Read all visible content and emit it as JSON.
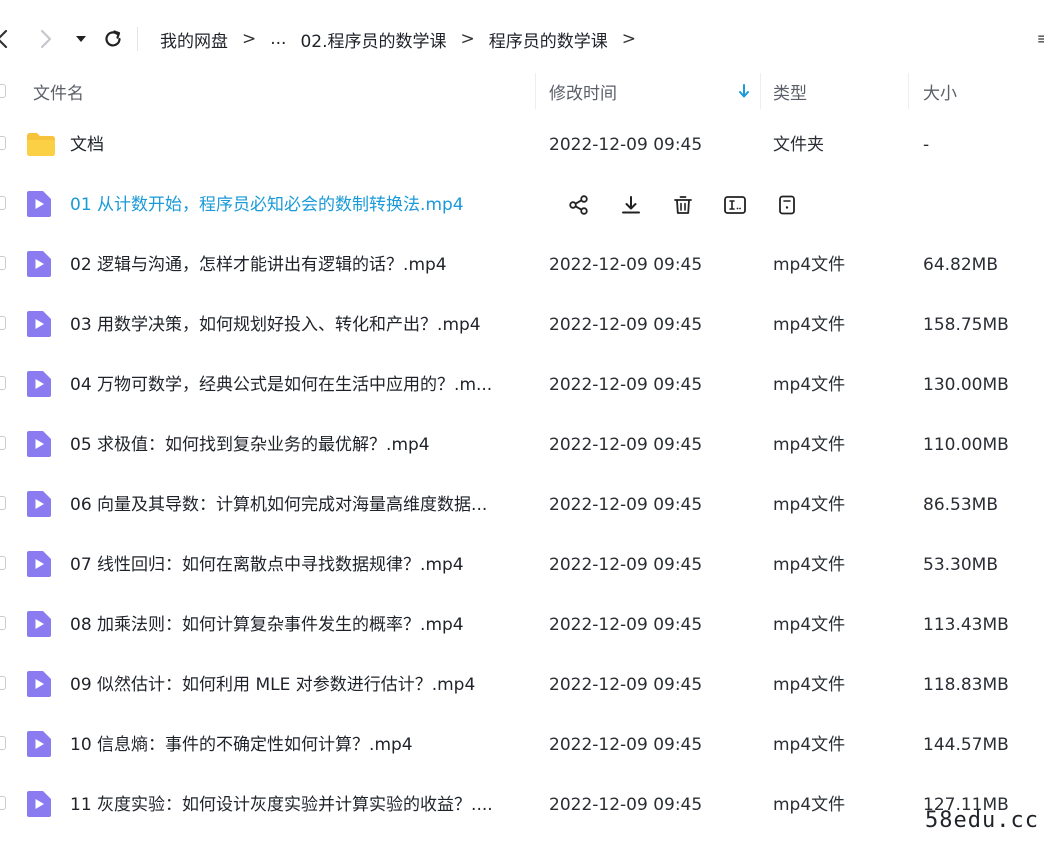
{
  "breadcrumb": {
    "items": [
      "我的网盘",
      "...",
      "02.程序员的数学课",
      "程序员的数学课"
    ],
    "separator": ">"
  },
  "columns": {
    "name": "文件名",
    "modified": "修改时间",
    "type": "类型",
    "size": "大小"
  },
  "files": [
    {
      "name": "文档",
      "time": "2022-12-09 09:45",
      "type": "文件夹",
      "size": "-",
      "kind": "folder"
    },
    {
      "name": "01 从计数开始，程序员必知必会的数制转换法.mp4",
      "time": "",
      "type": "",
      "size": "",
      "kind": "video",
      "hover": true
    },
    {
      "name": "02 逻辑与沟通，怎样才能讲出有逻辑的话？.mp4",
      "time": "2022-12-09 09:45",
      "type": "mp4文件",
      "size": "64.82MB",
      "kind": "video"
    },
    {
      "name": "03 用数学决策，如何规划好投入、转化和产出？.mp4",
      "time": "2022-12-09 09:45",
      "type": "mp4文件",
      "size": "158.75MB",
      "kind": "video"
    },
    {
      "name": "04 万物可数学，经典公式是如何在生活中应用的？.m...",
      "time": "2022-12-09 09:45",
      "type": "mp4文件",
      "size": "130.00MB",
      "kind": "video"
    },
    {
      "name": "05 求极值：如何找到复杂业务的最优解？.mp4",
      "time": "2022-12-09 09:45",
      "type": "mp4文件",
      "size": "110.00MB",
      "kind": "video"
    },
    {
      "name": "06 向量及其导数：计算机如何完成对海量高维度数据...",
      "time": "2022-12-09 09:45",
      "type": "mp4文件",
      "size": "86.53MB",
      "kind": "video"
    },
    {
      "name": "07 线性回归：如何在离散点中寻找数据规律？.mp4",
      "time": "2022-12-09 09:45",
      "type": "mp4文件",
      "size": "53.30MB",
      "kind": "video"
    },
    {
      "name": "08 加乘法则：如何计算复杂事件发生的概率？.mp4",
      "time": "2022-12-09 09:45",
      "type": "mp4文件",
      "size": "113.43MB",
      "kind": "video"
    },
    {
      "name": "09 似然估计：如何利用 MLE 对参数进行估计？.mp4",
      "time": "2022-12-09 09:45",
      "type": "mp4文件",
      "size": "118.83MB",
      "kind": "video"
    },
    {
      "name": "10 信息熵：事件的不确定性如何计算？.mp4",
      "time": "2022-12-09 09:45",
      "type": "mp4文件",
      "size": "144.57MB",
      "kind": "video"
    },
    {
      "name": "11 灰度实验：如何设计灰度实验并计算实验的收益？....",
      "time": "2022-12-09 09:45",
      "type": "mp4文件",
      "size": "127.11MB",
      "kind": "video"
    }
  ],
  "hover_actions": [
    "share-icon",
    "download-icon",
    "delete-icon",
    "rename-icon",
    "more-icon"
  ],
  "colors": {
    "accent": "#1a9ad8",
    "folder": "#f7c33b",
    "video": "#8a7cf0",
    "sort_arrow": "#1a9ad8"
  },
  "watermark": "58edu.cc"
}
